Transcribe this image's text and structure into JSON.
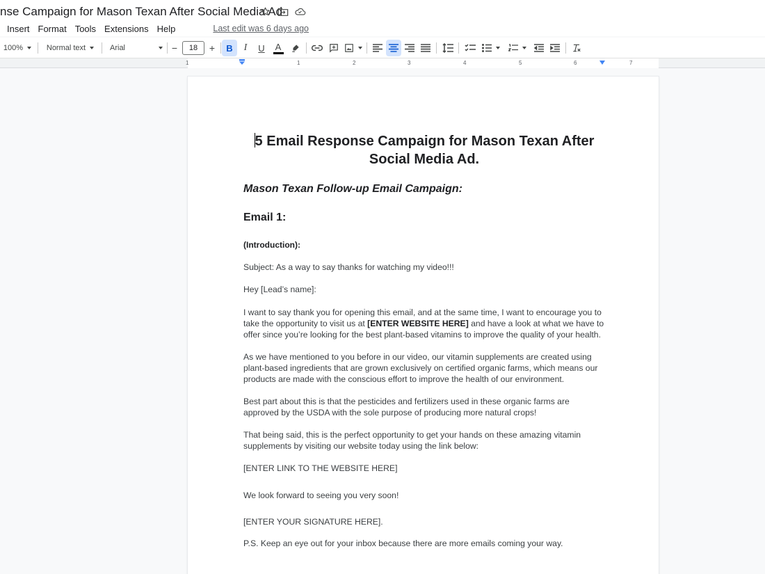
{
  "window": {
    "title": "nse Campaign for Mason Texan After Social Media Ad"
  },
  "menu": {
    "items": [
      "Insert",
      "Format",
      "Tools",
      "Extensions",
      "Help"
    ],
    "last_edit": "Last edit was 6 days ago"
  },
  "toolbar": {
    "zoom": "100%",
    "style": "Normal text",
    "font": "Arial",
    "font_size": "18",
    "minus": "−",
    "plus": "+",
    "bold_label": "B",
    "italic_label": "I",
    "underline_label": "U",
    "text_color_label": "A",
    "text_color": "#000000",
    "active": "center-align"
  },
  "ruler": {
    "numbers": [
      "1",
      "1",
      "2",
      "3",
      "4",
      "5",
      "6",
      "7"
    ]
  },
  "document": {
    "heading_line1": "5 Email Response Campaign for Mason Texan After",
    "heading_line2": "Social Media Ad.",
    "subheading": "Mason Texan Follow-up Email Campaign:",
    "email_heading": "Email 1:",
    "intro_label": "(Introduction):",
    "subject": "Subject: As a way to say thanks for watching my video!!!",
    "greeting": "Hey [Lead’s name]:",
    "para1_a": "I want to say thank you for opening this email, and at the same time, I want to encourage you to take the opportunity to visit us at ",
    "para1_bold": "[ENTER WEBSITE HERE]",
    "para1_b": " and have a look at what we have to offer since you’re looking for the best plant-based vitamins to improve the quality of your health.",
    "para2": "As we have mentioned to you before in our video, our vitamin supplements are created using plant-based ingredients that are grown exclusively on certified organic farms, which means our products are made with the conscious effort to improve the health of our environment.",
    "para3": "Best part about this is that the pesticides and fertilizers used in these organic farms are approved by the USDA with the sole purpose of producing more natural crops!",
    "para4": "That being said, this is the perfect opportunity to get your hands on these amazing vitamin supplements by visiting our website today using the link below:",
    "link_placeholder": "[ENTER LINK TO THE WEBSITE HERE]",
    "closing": "We look forward to seeing you very soon!",
    "signature": "[ENTER YOUR SIGNATURE HERE].",
    "ps": "P.S. Keep an eye out for your inbox because there are more emails coming your way."
  }
}
